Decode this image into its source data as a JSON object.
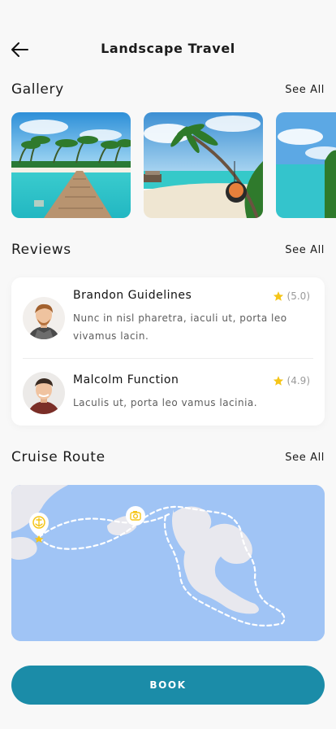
{
  "header": {
    "title": "Landscape Travel"
  },
  "gallery": {
    "title": "Gallery",
    "see_all": "See All"
  },
  "reviews": {
    "title": "Reviews",
    "see_all": "See All",
    "items": [
      {
        "name": "Brandon Guidelines",
        "rating": "(5.0)",
        "text": "Nunc in nisl pharetra, iaculi ut, porta leo vivamus lacin."
      },
      {
        "name": "Malcolm Function",
        "rating": "(4.9)",
        "text": "Laculis ut, porta leo vamus lacinia."
      }
    ]
  },
  "cruise": {
    "title": "Cruise Route",
    "see_all": "See All"
  },
  "actions": {
    "book_label": "BOOK"
  },
  "colors": {
    "accent": "#1b8ca8",
    "star": "#f5c518",
    "map_water": "#a0c4f5",
    "map_land": "#e8e8ee"
  }
}
